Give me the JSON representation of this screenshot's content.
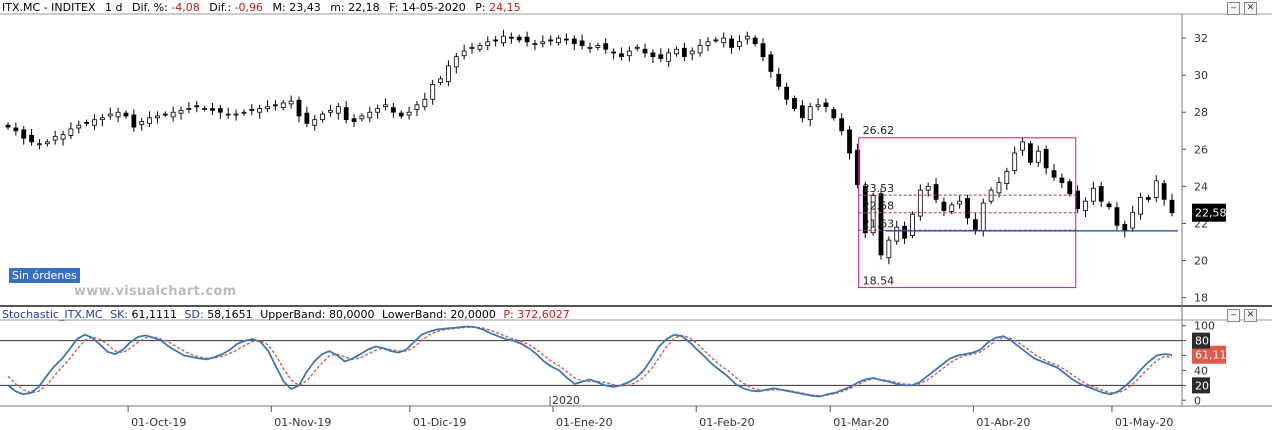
{
  "price_header": {
    "symbol": "ITX.MC - INDITEX",
    "period": "1 d",
    "dif_pct_label": "Dif. %:",
    "dif_pct_value": "-4,08",
    "dif_label": "Dif.:",
    "dif_value": "-0,96",
    "max_label": "M:",
    "max_value": "23,43",
    "min_label": "m:",
    "min_value": "22,18",
    "date_label": "F:",
    "date_value": "14-05-2020",
    "price_label": "P:",
    "price_value": "24,15"
  },
  "stoch_header": {
    "name": "Stochastic_ITX.MC",
    "sk_label": "SK:",
    "sk_value": "61,1111",
    "sd_label": "SD:",
    "sd_value": "58,1651",
    "upper_label": "UpperBand:",
    "upper_value": "80,0000",
    "lower_label": "LowerBand:",
    "lower_value": "20,0000",
    "p_label": "P:",
    "p_value": "372,6027"
  },
  "window_buttons": {
    "minimize": "‒",
    "close": "✕"
  },
  "orders_badge": "Sin órdenes",
  "watermark": "www.visualchart.com",
  "colors": {
    "up_fill": "#ffffff",
    "down_fill": "#000000",
    "range_box": "#c01fa0",
    "fib_lines": "#c01fa0",
    "support_line": "#1f3fa5",
    "price_tag_bg": "#000000",
    "sk_line": "#3b78b8",
    "sd_line": "#e0584a",
    "band_tag_bg": "#2b2b2b"
  },
  "chart_data": [
    {
      "type": "candlestick",
      "title": "ITX.MC - INDITEX",
      "ylim": [
        17.6,
        33.3
      ],
      "yticks": [
        18,
        20,
        22,
        24,
        26,
        28,
        30,
        32
      ],
      "xticks": [
        {
          "label": "01-Oct-19",
          "date": "2019-10-01"
        },
        {
          "label": "01-Nov-19",
          "date": "2019-11-01"
        },
        {
          "label": "01-Dic-19",
          "date": "2019-12-01"
        },
        {
          "label": "01-Ene-20",
          "date": "2020-01-01"
        },
        {
          "label": "01-Feb-20",
          "date": "2020-02-01"
        },
        {
          "label": "01-Mar-20",
          "date": "2020-03-01"
        },
        {
          "label": "01-Abr-20",
          "date": "2020-04-01"
        },
        {
          "label": "01-May-20",
          "date": "2020-05-01"
        }
      ],
      "year_marker": "2020",
      "last_price_tag": "22,58",
      "range_box": {
        "high": 26.62,
        "low": 18.54,
        "high_label": "26.62",
        "low_label": "18.54"
      },
      "levels": [
        {
          "value": 23.53,
          "label": "23.53"
        },
        {
          "value": 22.58,
          "label": "22.58"
        },
        {
          "value": 21.63,
          "label": "21.63"
        }
      ],
      "support_level": 21.6,
      "close_series": [
        27.2,
        27.0,
        26.6,
        26.4,
        26.3,
        26.4,
        26.7,
        26.8,
        27.1,
        27.3,
        27.4,
        27.6,
        27.7,
        27.9,
        28.0,
        27.8,
        27.2,
        27.5,
        27.7,
        27.8,
        27.9,
        28.0,
        28.1,
        28.2,
        28.3,
        28.2,
        28.1,
        28.0,
        27.9,
        27.9,
        28.0,
        28.1,
        28.2,
        28.3,
        28.4,
        28.5,
        28.6,
        27.8,
        27.4,
        27.6,
        27.9,
        28.1,
        28.3,
        27.6,
        27.5,
        27.8,
        28.0,
        28.2,
        28.4,
        28.0,
        27.8,
        28.0,
        28.4,
        28.7,
        29.5,
        29.8,
        30.5,
        31.0,
        31.3,
        31.5,
        31.6,
        31.8,
        31.9,
        32.1,
        32.0,
        31.9,
        31.8,
        31.7,
        31.8,
        31.9,
        32.0,
        31.9,
        31.7,
        31.6,
        31.5,
        31.6,
        31.4,
        31.2,
        31.0,
        31.3,
        31.5,
        31.2,
        31.0,
        30.9,
        31.2,
        31.4,
        31.0,
        31.3,
        31.6,
        31.8,
        31.9,
        32.0,
        31.5,
        31.8,
        32.1,
        31.7,
        31.0,
        30.2,
        29.4,
        28.7,
        28.2,
        27.7,
        28.3,
        28.4,
        28.3,
        27.7,
        27.0,
        25.8,
        24.1,
        21.5,
        23.5,
        20.3,
        21.1,
        21.8,
        21.2,
        22.5,
        23.8,
        24.0,
        23.3,
        22.7,
        23.0,
        23.2,
        22.3,
        21.6,
        23.1,
        23.8,
        24.2,
        24.8,
        25.8,
        26.4,
        25.3,
        25.9,
        25.0,
        24.5,
        24.2,
        23.6,
        22.8,
        23.2,
        23.9,
        23.2,
        22.9,
        21.9,
        21.6,
        22.6,
        23.4,
        23.3,
        24.3,
        23.3,
        22.58
      ],
      "xlabel": "",
      "ylabel": ""
    },
    {
      "type": "line",
      "title": "Stochastic_ITX.MC",
      "ylim": [
        -5,
        105
      ],
      "yticks": [
        0,
        20,
        40,
        60,
        80,
        100
      ],
      "bands": [
        20,
        80
      ],
      "tags": {
        "sk": "61,11",
        "upper": "80",
        "lower": "20"
      },
      "series": [
        {
          "name": "SK",
          "values": [
            20,
            12,
            8,
            10,
            18,
            32,
            45,
            55,
            68,
            82,
            88,
            84,
            75,
            65,
            62,
            68,
            78,
            85,
            87,
            84,
            80,
            72,
            66,
            60,
            58,
            56,
            55,
            58,
            62,
            68,
            76,
            80,
            82,
            78,
            66,
            45,
            25,
            15,
            20,
            38,
            52,
            62,
            66,
            60,
            52,
            56,
            62,
            68,
            72,
            70,
            66,
            64,
            68,
            78,
            88,
            92,
            95,
            96,
            97,
            98,
            99,
            98,
            95,
            90,
            86,
            82,
            80,
            76,
            70,
            62,
            52,
            45,
            40,
            30,
            22,
            25,
            28,
            24,
            20,
            18,
            20,
            24,
            30,
            40,
            55,
            72,
            82,
            88,
            86,
            78,
            68,
            58,
            48,
            40,
            32,
            22,
            16,
            13,
            12,
            14,
            16,
            14,
            12,
            10,
            8,
            6,
            5,
            8,
            10,
            14,
            18,
            24,
            28,
            30,
            27,
            25,
            22,
            20,
            20,
            24,
            32,
            40,
            48,
            56,
            60,
            62,
            64,
            68,
            78,
            84,
            86,
            80,
            72,
            64,
            56,
            52,
            48,
            44,
            36,
            28,
            22,
            18,
            14,
            10,
            8,
            12,
            20,
            30,
            42,
            52,
            60,
            62,
            61
          ]
        },
        {
          "name": "SD",
          "values": [
            32,
            22,
            14,
            10,
            12,
            20,
            32,
            44,
            55,
            68,
            80,
            85,
            82,
            75,
            66,
            64,
            70,
            78,
            84,
            85,
            82,
            78,
            72,
            66,
            61,
            58,
            56,
            57,
            59,
            63,
            68,
            74,
            79,
            80,
            74,
            60,
            42,
            27,
            20,
            26,
            38,
            50,
            60,
            62,
            58,
            55,
            57,
            62,
            67,
            70,
            68,
            66,
            66,
            71,
            80,
            88,
            92,
            95,
            96,
            97,
            98,
            98,
            97,
            94,
            90,
            86,
            82,
            79,
            75,
            68,
            60,
            52,
            46,
            38,
            30,
            26,
            25,
            25,
            24,
            21,
            19,
            20,
            24,
            31,
            42,
            57,
            72,
            83,
            87,
            84,
            76,
            66,
            56,
            47,
            40,
            31,
            23,
            17,
            14,
            13,
            14,
            14,
            13,
            11,
            9,
            7,
            6,
            7,
            9,
            12,
            16,
            21,
            26,
            29,
            28,
            26,
            24,
            22,
            21,
            22,
            27,
            34,
            42,
            50,
            56,
            60,
            62,
            65,
            72,
            80,
            84,
            83,
            77,
            70,
            62,
            56,
            51,
            47,
            41,
            34,
            27,
            21,
            17,
            13,
            10,
            10,
            15,
            23,
            33,
            44,
            53,
            59,
            58
          ]
        }
      ],
      "xlabel": "",
      "ylabel": ""
    }
  ]
}
